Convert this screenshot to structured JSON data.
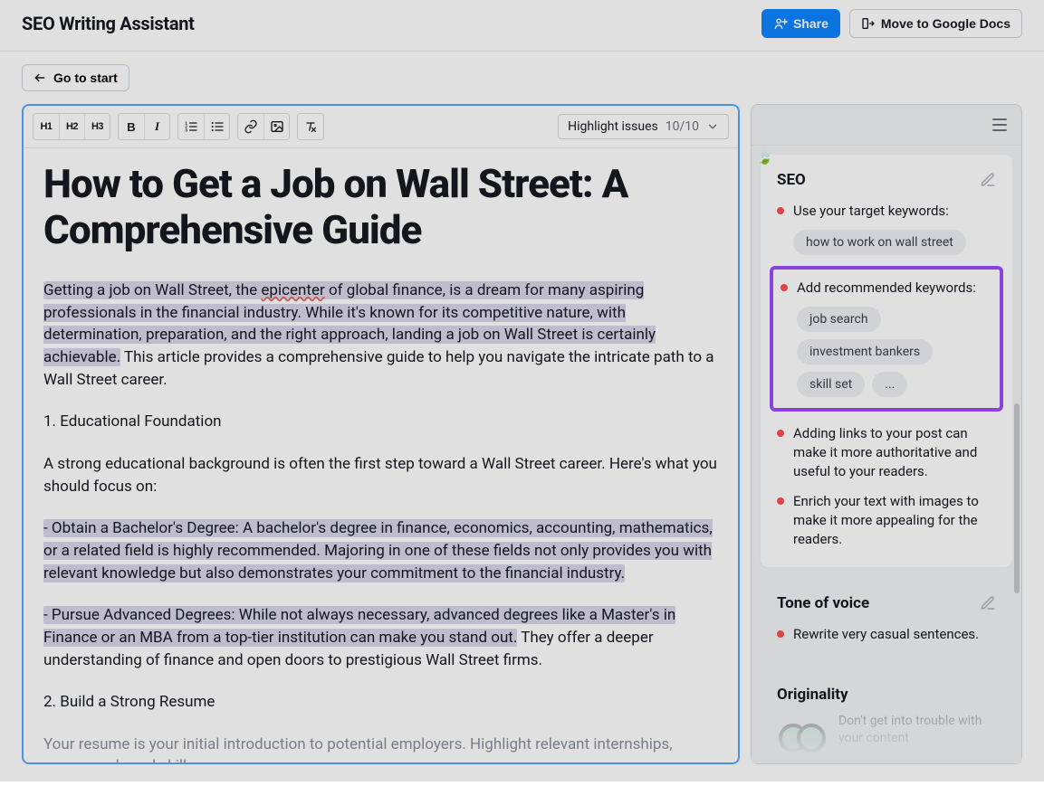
{
  "header": {
    "title": "SEO Writing Assistant",
    "share_label": "Share",
    "move_label": "Move to Google Docs"
  },
  "subnav": {
    "go_to_start": "Go to start"
  },
  "toolbar": {
    "h1": "H1",
    "h2": "H2",
    "h3": "H3",
    "highlight_label": "Highlight issues",
    "highlight_count": "10/10"
  },
  "editor": {
    "title": "How to Get a Job on Wall Street: A Comprehensive Guide",
    "p1_a": "Getting a job on Wall Street, the ",
    "p1_epicenter": "epicenter",
    "p1_b": " of global finance, is a dream for many aspiring professionals in the financial industry. While it's known for its competitive nature, with determination, preparation, and the right approach, landing a job on Wall Street is certainly achievable.",
    "p1_c": " This article provides a comprehensive guide to help you navigate the intricate path to a Wall Street career.",
    "p2": "1. Educational Foundation",
    "p3": "A strong educational background is often the first step toward a Wall Street career. Here's what you should focus on:",
    "p4_a": "- Obtain a Bachelor's Degree: A bachelor's degree in finance, economics, accounting, mathematics, or a related field is highly recommended. Majoring in one of these fields not only provides you with relevant knowledge but also demonstrates your commitment to the financial industry.",
    "p5_a": "- Pursue Advanced Degrees: While not always necessary, advanced degrees like a Master's in Finance or an MBA from a top-tier institution can make you stand out.",
    "p5_b": " They offer a deeper understanding of finance and open doors to prestigious Wall Street firms.",
    "p6": "2. Build a Strong Resume",
    "p7": "Your resume is your initial introduction to potential employers. Highlight relevant internships, coursework, and skills:"
  },
  "seo": {
    "title": "SEO",
    "target_label": "Use your target keywords:",
    "target_chip": "how to work on wall street",
    "recommended_label": "Add recommended keywords:",
    "chips": {
      "0": "job search",
      "1": "investment bankers",
      "2": "skill set",
      "3": "..."
    },
    "links_text": "Adding links to your post can make it more authoritative and useful to your readers.",
    "images_text": "Enrich your text with images to make it more appealing for the readers."
  },
  "tone": {
    "title": "Tone of voice",
    "text": "Rewrite very casual sentences."
  },
  "originality": {
    "title": "Originality",
    "text": "Don't get into trouble with your content"
  }
}
